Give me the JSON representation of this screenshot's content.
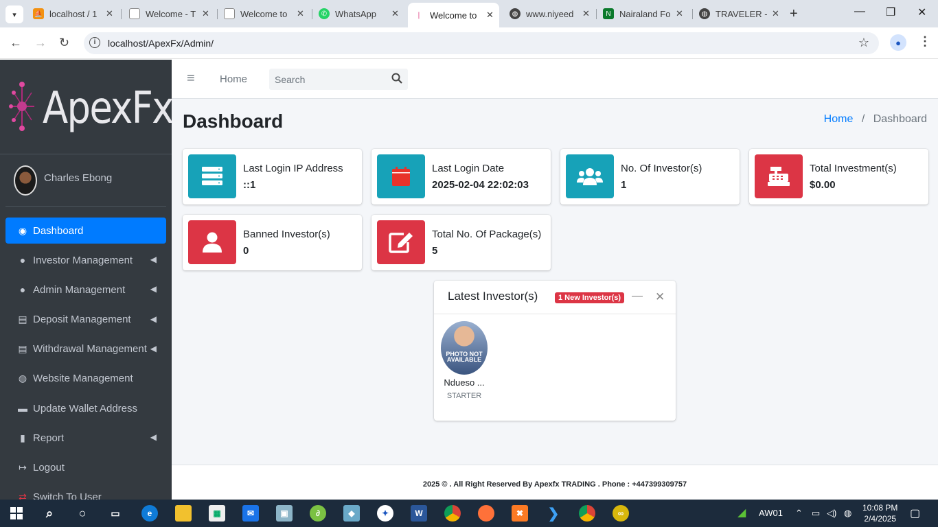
{
  "browser": {
    "tabs": [
      {
        "title": "localhost / 1",
        "color": "#f29111"
      },
      {
        "title": "Welcome - T",
        "color": "#888888"
      },
      {
        "title": "Welcome to",
        "color": "#888888"
      },
      {
        "title": "WhatsApp",
        "color": "#25d366"
      },
      {
        "title": "Welcome to",
        "color": "#e04a8a"
      },
      {
        "title": "www.niyeed",
        "color": "#444444"
      },
      {
        "title": "Nairaland Fo",
        "color": "#0b7a2c"
      },
      {
        "title": "TRAVELER - I",
        "color": "#444444"
      }
    ],
    "url": "localhost/ApexFx/Admin/"
  },
  "brand": {
    "name": "ApexFx"
  },
  "user": {
    "name": "Charles Ebong"
  },
  "sidebar": {
    "items": [
      {
        "label": "Dashboard",
        "icon": "gauge-icon",
        "glyph": "◉"
      },
      {
        "label": "Investor Management",
        "icon": "user-icon",
        "glyph": "●"
      },
      {
        "label": "Admin Management",
        "icon": "user-plus-icon",
        "glyph": "●"
      },
      {
        "label": "Deposit Management",
        "icon": "cash-register-icon",
        "glyph": "▤"
      },
      {
        "label": "Withdrawal Management",
        "icon": "cash-register-icon",
        "glyph": "▤"
      },
      {
        "label": "Website Management",
        "icon": "globe-icon",
        "glyph": "◍"
      },
      {
        "label": "Update Wallet Address",
        "icon": "wallet-icon",
        "glyph": "▬"
      },
      {
        "label": "Report",
        "icon": "file-icon",
        "glyph": "▮"
      },
      {
        "label": "Logout",
        "icon": "sign-out-icon",
        "glyph": "↦"
      },
      {
        "label": "Switch To User",
        "icon": "switch-icon",
        "glyph": "⇄"
      }
    ]
  },
  "topnav": {
    "home": "Home",
    "search_placeholder": "Search"
  },
  "page": {
    "title": "Dashboard",
    "breadcrumb": {
      "home": "Home",
      "current": "Dashboard"
    }
  },
  "stats": [
    {
      "label": "Last Login IP Address",
      "value": "::1",
      "icon": "server-icon",
      "color": "#17a2b8"
    },
    {
      "label": "Last Login Date",
      "value": "2025-02-04 22:02:03",
      "icon": "calendar-icon",
      "color": "#17a2b8"
    },
    {
      "label": "No. Of Investor(s)",
      "value": "1",
      "icon": "users-icon",
      "color": "#17a2b8"
    },
    {
      "label": "Total Investment(s)",
      "value": "$0.00",
      "icon": "cash-register-icon",
      "color": "#dc3545"
    },
    {
      "label": "Banned Investor(s)",
      "value": "0",
      "icon": "user-icon",
      "color": "#dc3545"
    },
    {
      "label": "Total No. Of Package(s)",
      "value": "5",
      "icon": "edit-icon",
      "color": "#dc3545"
    }
  ],
  "latest": {
    "title": "Latest Investor(s)",
    "badge": "1 New Investor(s)",
    "photo_text": "PHOTO NOT AVAILABLE",
    "members": [
      {
        "name": "Ndueso ...",
        "plan": "STARTER"
      }
    ]
  },
  "footer": {
    "text": "2025 © . All Right Reserved By Apexfx TRADING . Phone : +447399309757"
  },
  "taskbar": {
    "network_label": "AW01",
    "time": "10:08 PM",
    "date": "2/4/2025"
  }
}
